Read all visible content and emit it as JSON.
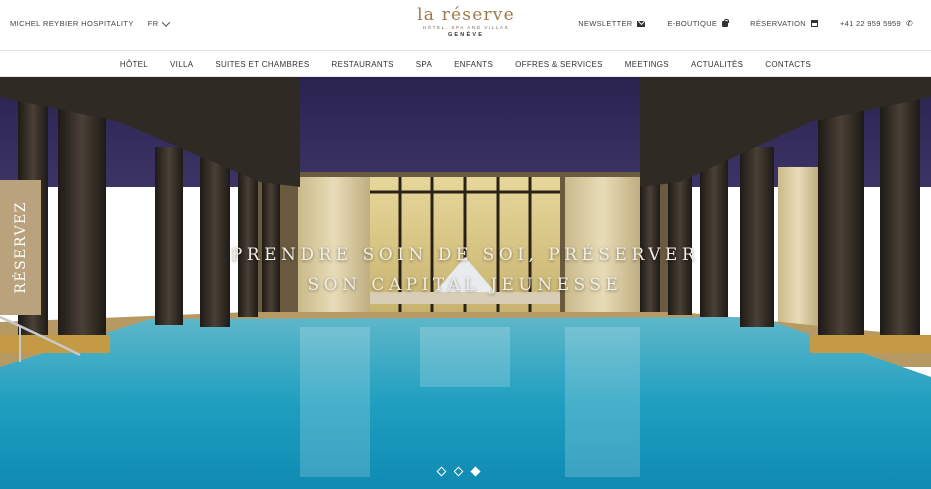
{
  "topbar": {
    "group_name": "MICHEL REYBIER HOSPITALITY",
    "language": "FR",
    "links": [
      {
        "label": "NEWSLETTER",
        "icon": "envelope-icon"
      },
      {
        "label": "E-BOUTIQUE",
        "icon": "bag-icon"
      },
      {
        "label": "RÉSERVATION",
        "icon": "calendar-icon"
      },
      {
        "label": "+41 22 959 5959",
        "icon": "phone-icon"
      }
    ]
  },
  "logo": {
    "brand": "la réserve",
    "tagline": "HÔTEL, SPA AND VILLAS",
    "city": "GENÈVE",
    "color": "#9b7a4a"
  },
  "nav": {
    "items": [
      "HÔTEL",
      "VILLA",
      "SUITES ET CHAMBRES",
      "RESTAURANTS",
      "SPA",
      "ENFANTS",
      "OFFRES & SERVICES",
      "MEETINGS",
      "ACTUALITÉS",
      "CONTACTS"
    ]
  },
  "hero": {
    "reserve_label": "RÉSERVEZ",
    "headline_line1": "PRENDRE SOIN DE SOI, PRÉSERVER",
    "headline_line2": "SON CAPITAL JEUNESSE",
    "slides_total": 3,
    "active_slide": 3,
    "accent": "#b9a27c"
  }
}
